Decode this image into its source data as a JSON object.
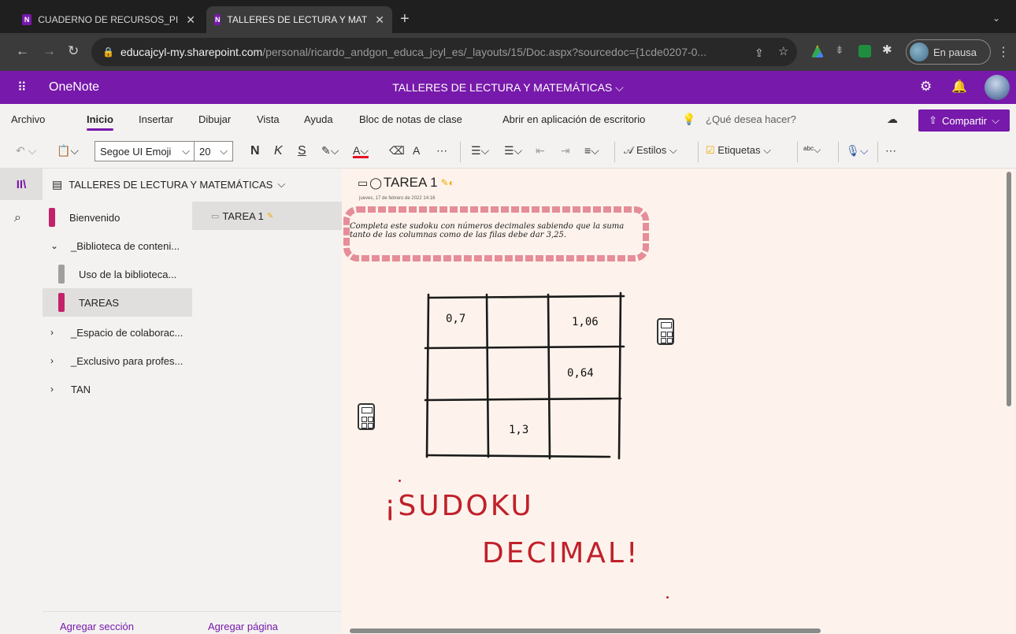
{
  "browser": {
    "tabs": [
      {
        "label": "CUADERNO DE RECURSOS_PI",
        "close": "✕"
      },
      {
        "label": "TALLERES DE LECTURA Y MAT",
        "close": "✕"
      }
    ],
    "new_tab": "+",
    "url_host": "educajcyl-my.sharepoint.com",
    "url_path": "/personal/ricardo_andgon_educa_jcyl_es/_layouts/15/Doc.aspx?sourcedoc={1cde0207-0...",
    "profile_status": "En pausa"
  },
  "onenote": {
    "app_name": "OneNote",
    "notebook_title": "TALLERES DE LECTURA Y MATEMÁTICAS ⌵"
  },
  "menu": {
    "items": [
      "Archivo",
      "Inicio",
      "Insertar",
      "Dibujar",
      "Vista",
      "Ayuda",
      "Bloc de notas de clase",
      "Abrir en aplicación de escritorio"
    ],
    "active": "Inicio",
    "search_hint": "¿Qué desea hacer?",
    "share": "Compartir"
  },
  "toolbar": {
    "font_name": "Segoe UI Emoji",
    "font_size": "20",
    "bold": "N",
    "italic": "K",
    "underline": "S",
    "styles": "Estilos",
    "tags": "Etiquetas"
  },
  "nav": {
    "notebook_header": "TALLERES DE LECTURA Y MATEMÁTICAS",
    "sections": [
      {
        "label": "Bienvenido",
        "color": "#c4216b"
      },
      {
        "label": "_Biblioteca de conteni..."
      },
      {
        "label": "Uso de la biblioteca...",
        "color": "#a19f9d"
      },
      {
        "label": "TAREAS",
        "color": "#c4216b"
      },
      {
        "label": "_Espacio de colaborac..."
      },
      {
        "label": "_Exclusivo para profes..."
      },
      {
        "label": "TAN"
      }
    ],
    "add_section": "Agregar sección",
    "pages": [
      {
        "label": "TAREA 1"
      }
    ],
    "add_page": "Agregar página"
  },
  "page": {
    "title": "TAREA 1",
    "date": "jueves, 17 de febrero de 2022   14:16",
    "instructions": "Completa este sudoku con números decimales sabiendo que la suma tanto de las columnas como de las filas debe dar 3,25.",
    "grid": [
      [
        "0,7",
        "",
        "1,06"
      ],
      [
        "",
        "",
        "0,64"
      ],
      [
        "",
        "1,3",
        ""
      ]
    ],
    "ink_line1": "¡SUDOKU",
    "ink_line2": "DECIMAL!"
  },
  "colors": {
    "brand": "#7719aa",
    "canvas": "#fdf3ec",
    "ink": "#c0202a",
    "highlight": "#e07a8a"
  }
}
